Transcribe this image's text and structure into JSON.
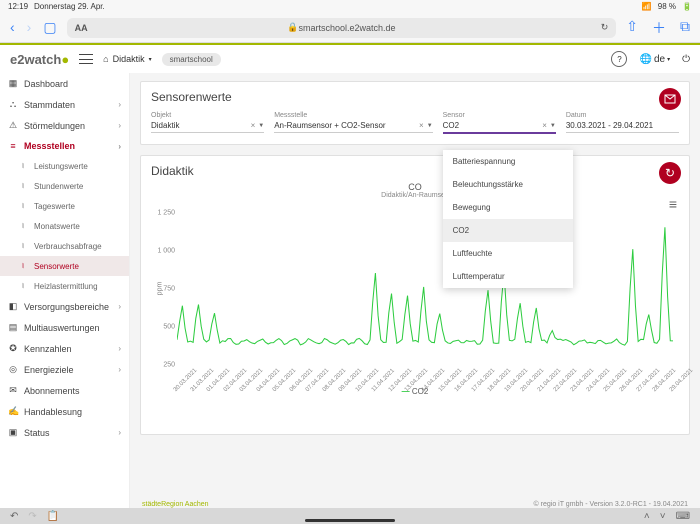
{
  "ios": {
    "time": "12:19",
    "date": "Donnerstag 29. Apr.",
    "battery": "98 %"
  },
  "safari": {
    "url": "smartschool.e2watch.de",
    "aa": "AA"
  },
  "brand": {
    "name": "e2watch"
  },
  "breadcrumb": {
    "home": "Didaktik",
    "pill": "smartschool",
    "lang": "de"
  },
  "sidebar": {
    "items": [
      {
        "label": "Dashboard",
        "ico": "▦"
      },
      {
        "label": "Stammdaten",
        "ico": "⛬",
        "chev": true
      },
      {
        "label": "Störmeldungen",
        "ico": "⚠",
        "chev": true
      },
      {
        "label": "Messstellen",
        "ico": "≡",
        "chev": true,
        "active": true
      },
      {
        "label": "Leistungswerte",
        "sub": true
      },
      {
        "label": "Stundenwerte",
        "sub": true
      },
      {
        "label": "Tageswerte",
        "sub": true
      },
      {
        "label": "Monatswerte",
        "sub": true
      },
      {
        "label": "Verbrauchsabfrage",
        "sub": true
      },
      {
        "label": "Sensorwerte",
        "sub": true,
        "sel": true
      },
      {
        "label": "Heizlastermittlung",
        "sub": true
      },
      {
        "label": "Versorgungsbereiche",
        "ico": "◧",
        "chev": true
      },
      {
        "label": "Multiauswertungen",
        "ico": "▤"
      },
      {
        "label": "Kennzahlen",
        "ico": "✪",
        "chev": true
      },
      {
        "label": "Energieziele",
        "ico": "◎",
        "chev": true
      },
      {
        "label": "Abonnements",
        "ico": "✉"
      },
      {
        "label": "Handablesung",
        "ico": "✍"
      },
      {
        "label": "Status",
        "ico": "▣",
        "chev": true
      }
    ],
    "footer_logo": "städteRegion Aachen"
  },
  "filters": {
    "title": "Sensorenwerte",
    "objekt": {
      "label": "Objekt",
      "value": "Didaktik"
    },
    "messstelle": {
      "label": "Messstelle",
      "value": "An-Raumsensor + CO2-Sensor"
    },
    "sensor": {
      "label": "Sensor",
      "value": "CO2",
      "options": [
        "Batteriespannung",
        "Beleuchtungsstärke",
        "Bewegung",
        "CO2",
        "Luftfeuchte",
        "Lufttemperatur"
      ],
      "selected": "CO2"
    },
    "datum": {
      "label": "Datum",
      "value": "30.03.2021 - 29.04.2021"
    }
  },
  "chart": {
    "title": "Didaktik",
    "subtitle": "CO",
    "subtitle_sub": "Didaktik/An-Raumsen",
    "legend": "CO2",
    "ylabel": "ppm"
  },
  "chart_data": {
    "type": "line",
    "xlabel": "",
    "ylabel": "ppm",
    "ylim": [
      250,
      1300
    ],
    "yticks": [
      250,
      500,
      750,
      1000,
      1250
    ],
    "categories": [
      "30.03.2021",
      "31.03.2021",
      "01.04.2021",
      "02.04.2021",
      "03.04.2021",
      "04.04.2021",
      "05.04.2021",
      "06.04.2021",
      "07.04.2021",
      "08.04.2021",
      "09.04.2021",
      "10.04.2021",
      "11.04.2021",
      "12.04.2021",
      "13.04.2021",
      "14.04.2021",
      "15.04.2021",
      "16.04.2021",
      "17.04.2021",
      "18.04.2021",
      "19.04.2021",
      "20.04.2021",
      "21.04.2021",
      "22.04.2021",
      "23.04.2021",
      "24.04.2021",
      "25.04.2021",
      "26.04.2021",
      "27.04.2021",
      "28.04.2021",
      "29.04.2021"
    ],
    "series": [
      {
        "name": "CO2",
        "baseline": 430,
        "daily_peaks": [
          650,
          680,
          620,
          430,
          430,
          430,
          430,
          430,
          430,
          430,
          430,
          430,
          850,
          740,
          720,
          760,
          620,
          430,
          430,
          760,
          860,
          680,
          640,
          500,
          430,
          430,
          430,
          430,
          1000,
          620,
          1150
        ]
      }
    ]
  },
  "footer": {
    "credit": "© regio iT gmbh - Version 3.2.0-RC1 - 19.04.2021"
  }
}
